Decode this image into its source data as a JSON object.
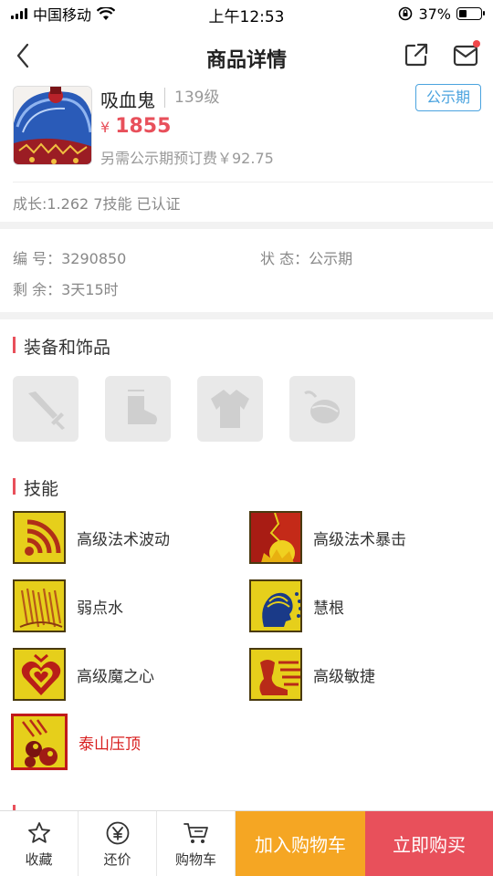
{
  "status_bar": {
    "carrier": "中国移动",
    "time": "上午12:53",
    "battery": "37%",
    "battery_level": 0.37
  },
  "nav": {
    "title": "商品详情"
  },
  "product": {
    "name": "吸血鬼",
    "level": "139级",
    "badge": "公示期",
    "currency": "¥",
    "price": "1855",
    "fee": "另需公示期预订费￥92.75",
    "growth": "成长:1.262 7技能 已认证"
  },
  "info": {
    "id_label": "编 号：",
    "id_value": "3290850",
    "status_label": "状 态：",
    "status_value": "公示期",
    "remain_label": "剩 余：",
    "remain_value": "3天15时"
  },
  "equipment": {
    "title": "装备和饰品",
    "slots": [
      "sword-icon",
      "boot-icon",
      "armor-icon",
      "necklace-icon"
    ]
  },
  "skills": {
    "title": "技能",
    "items": [
      {
        "name": "高级法术波动",
        "icon": "wave-skill-icon"
      },
      {
        "name": "高级法术暴击",
        "icon": "crit-skill-icon"
      },
      {
        "name": "弱点水",
        "icon": "water-weak-skill-icon"
      },
      {
        "name": "慧根",
        "icon": "wisdom-skill-icon"
      },
      {
        "name": "高级魔之心",
        "icon": "magic-heart-skill-icon"
      },
      {
        "name": "高级敏捷",
        "icon": "agility-skill-icon"
      },
      {
        "name": "泰山压顶",
        "icon": "taishan-skill-icon"
      }
    ]
  },
  "bottom_bar": {
    "favorite": "收藏",
    "bargain": "还价",
    "cart": "购物车",
    "add_to_cart": "加入购物车",
    "buy_now": "立即购买"
  },
  "colors": {
    "accent_red": "#e8505b",
    "accent_orange": "#f5a623",
    "badge_blue": "#4aa3df",
    "skill_highlight": "#d81e1e"
  }
}
